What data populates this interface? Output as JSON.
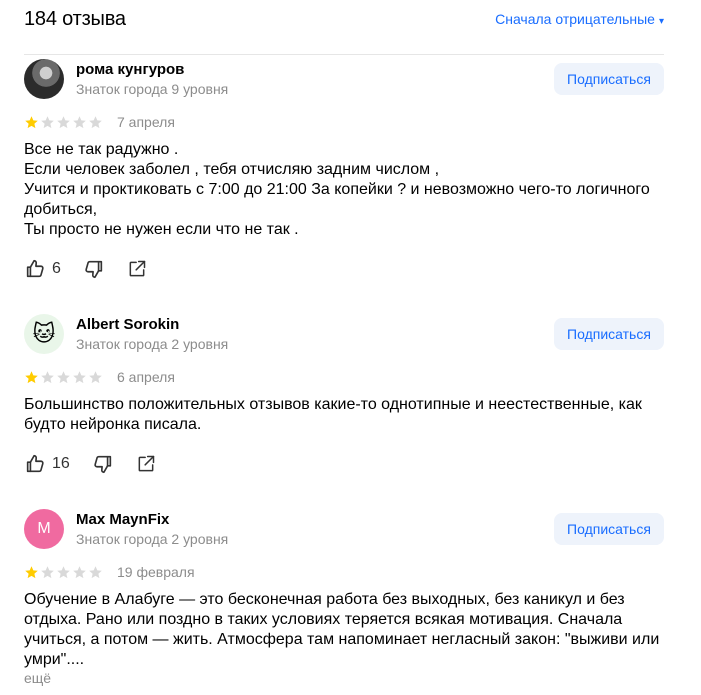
{
  "header": {
    "count_title": "184 отзыва",
    "sort_label": "Сначала отрицательные",
    "sort_caret": "▾"
  },
  "colors": {
    "accent": "#196dff",
    "star_filled": "#fc0",
    "star_empty": "#d9d9d9",
    "subscribe_bg": "#eef3fb"
  },
  "reviews": [
    {
      "author": "рома кунгуров",
      "level": "Знаток города 9 уровня",
      "avatar": "photo",
      "subscribe_label": "Подписаться",
      "rating": 1,
      "date": "7 апреля",
      "text": "Все не так радужно .\nЕсли человек заболел , тебя отчисляю задним числом ,\nУчится и проктиковать с 7:00 до 21:00 За копейки ? и невозможно чего-то логичного добиться,\nТы просто не нужен если что не так .",
      "likes": "6"
    },
    {
      "author": "Albert Sorokin",
      "level": "Знаток города 2 уровня",
      "avatar": "cat",
      "avatar_glyph": "🐱",
      "subscribe_label": "Подписаться",
      "rating": 1,
      "date": "6 апреля",
      "text": "Большинство положительных отзывов какие-то однотипные и неестественные, как будто нейронка писала.",
      "likes": "16"
    },
    {
      "author": "Max MaynFix",
      "level": "Знаток города 2 уровня",
      "avatar": "letter",
      "avatar_glyph": "M",
      "subscribe_label": "Подписаться",
      "rating": 1,
      "date": "19 февраля",
      "text": "Обучение в Алабуге — это бесконечная работа без выходных, без каникул и без отдыха. Рано или поздно в таких условиях теряется всякая мотивация. Сначала учиться, а потом — жить. Атмосфера там напоминает негласный закон: \"выживи или умри\"....",
      "more_label": "ещё"
    }
  ],
  "icons": {
    "like": "thumbs-up-icon",
    "dislike": "thumbs-down-icon",
    "share": "share-icon",
    "star": "star-icon"
  }
}
